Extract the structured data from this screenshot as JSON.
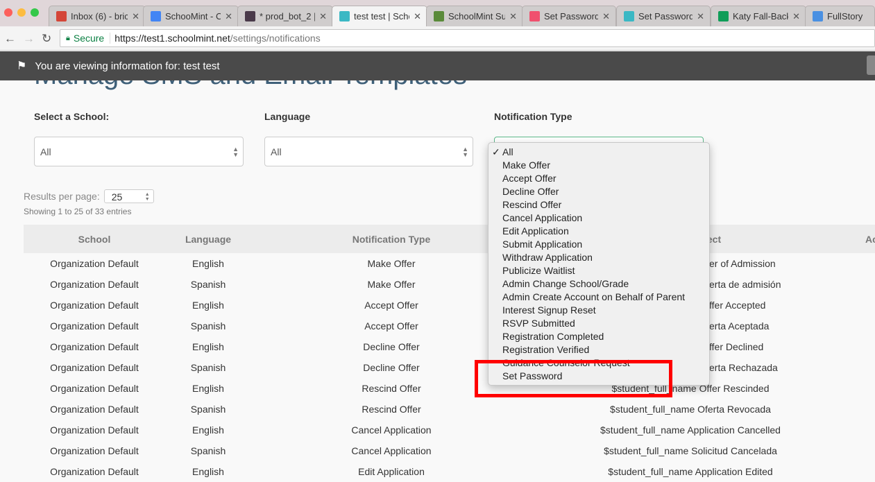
{
  "browser": {
    "tabs": [
      {
        "label": "Inbox (6) - bric",
        "icon": "gmail-icon",
        "color": "#d44638"
      },
      {
        "label": "SchooMint - C",
        "icon": "calendar-icon",
        "color": "#4285f4"
      },
      {
        "label": "* prod_bot_2 |",
        "icon": "slack-icon",
        "color": "#4a3a4a"
      },
      {
        "label": "test test | Scho",
        "icon": "schoolmint-leaf-icon",
        "color": "#3bb8c4",
        "active": true
      },
      {
        "label": "SchoolMint Su",
        "icon": "zendesk-icon",
        "color": "#5a8a3a"
      },
      {
        "label": "Set Password",
        "icon": "mountain-icon",
        "color": "#f0506e"
      },
      {
        "label": "Set Password",
        "icon": "schoolmint-leaf-icon",
        "color": "#3bb8c4"
      },
      {
        "label": "Katy Fall-Back",
        "icon": "sheets-icon",
        "color": "#0f9d58"
      },
      {
        "label": "FullStory",
        "icon": "fullstory-icon",
        "color": "#4a90e2"
      }
    ],
    "secure_label": "Secure",
    "url_host": "https://test1.schoolmint.net",
    "url_path": "/settings/notifications"
  },
  "banner": {
    "text": "You are viewing information for: test test"
  },
  "page": {
    "title": "Manage SMS and Email Templates",
    "filters": {
      "school_label": "Select a School:",
      "school_value": "All",
      "language_label": "Language",
      "language_value": "All",
      "type_label": "Notification Type",
      "type_value": "All"
    },
    "results_label": "Results per page:",
    "results_value": "25",
    "showing": "Showing 1 to 25 of 33 entries"
  },
  "table": {
    "headers": [
      "School",
      "Language",
      "Notification Type",
      "ect",
      "Ac"
    ],
    "rows": [
      [
        "Organization Default",
        "English",
        "Make Offer",
        "er of Admission",
        true
      ],
      [
        "Organization Default",
        "Spanish",
        "Make Offer",
        "erta de admisión",
        true
      ],
      [
        "Organization Default",
        "English",
        "Accept Offer",
        "ffer Accepted",
        true
      ],
      [
        "Organization Default",
        "Spanish",
        "Accept Offer",
        "erta Aceptada",
        true
      ],
      [
        "Organization Default",
        "English",
        "Decline Offer",
        "ffer Declined",
        true
      ],
      [
        "Organization Default",
        "Spanish",
        "Decline Offer",
        "erta Rechazada",
        true
      ],
      [
        "Organization Default",
        "English",
        "Rescind Offer",
        "$student_full_name Offer Rescinded",
        false
      ],
      [
        "Organization Default",
        "Spanish",
        "Rescind Offer",
        "$student_full_name Oferta Revocada",
        false
      ],
      [
        "Organization Default",
        "English",
        "Cancel Application",
        "$student_full_name Application Cancelled",
        false
      ],
      [
        "Organization Default",
        "Spanish",
        "Cancel Application",
        "$student_full_name Solicitud Cancelada",
        false
      ],
      [
        "Organization Default",
        "English",
        "Edit Application",
        "$student_full_name Application Edited",
        false
      ]
    ]
  },
  "dropdown": {
    "selected": "All",
    "options": [
      "All",
      "Make Offer",
      "Accept Offer",
      "Decline Offer",
      "Rescind Offer",
      "Cancel Application",
      "Edit Application",
      "Submit Application",
      "Withdraw Application",
      "Publicize Waitlist",
      "Admin Change School/Grade",
      "Admin Create Account on Behalf of Parent",
      "Interest Signup Reset",
      "RSVP Submitted",
      "Registration Completed",
      "Registration Verified",
      "Guidance Counselor Request",
      "Set Password"
    ]
  },
  "colors": {
    "highlight": "#ff0000",
    "banner": "#4a4a4a",
    "title": "#3f6079"
  }
}
